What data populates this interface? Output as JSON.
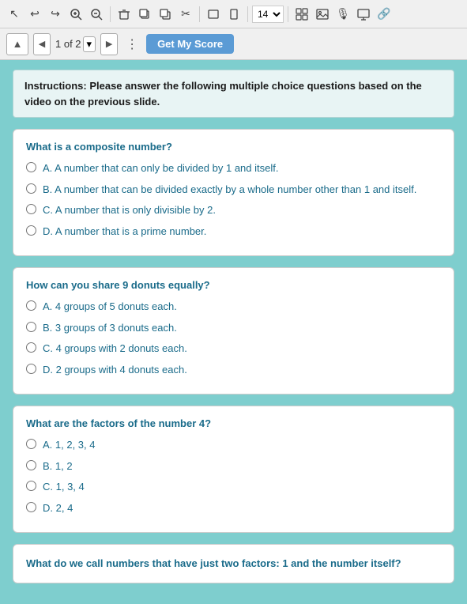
{
  "toolbar": {
    "icons": [
      {
        "name": "cursor",
        "symbol": "↖"
      },
      {
        "name": "undo",
        "symbol": "↩"
      },
      {
        "name": "redo",
        "symbol": "↪"
      },
      {
        "name": "zoom-in",
        "symbol": "🔍+"
      },
      {
        "name": "zoom-out",
        "symbol": "🔍-"
      },
      {
        "name": "delete",
        "symbol": "🗑"
      },
      {
        "name": "copy1",
        "symbol": "⧉"
      },
      {
        "name": "copy2",
        "symbol": "❐"
      },
      {
        "name": "cut",
        "symbol": "✂"
      },
      {
        "name": "frame1",
        "symbol": "▭"
      },
      {
        "name": "frame2",
        "symbol": "▯"
      },
      {
        "name": "zoom-value",
        "symbol": "14"
      },
      {
        "name": "grid",
        "symbol": "⊞"
      },
      {
        "name": "image",
        "symbol": "🖼"
      },
      {
        "name": "mic",
        "symbol": "🎙"
      },
      {
        "name": "screen",
        "symbol": "🖥"
      },
      {
        "name": "link",
        "symbol": "🔗"
      }
    ],
    "zoom_label": "14"
  },
  "nav": {
    "up_icon": "▲",
    "prev_icon": "◀",
    "next_icon": "▶",
    "page_info": "1 of 2",
    "dropdown_arrow": "▾",
    "more_icon": "⋮",
    "get_score_label": "Get My Score"
  },
  "instructions": {
    "text": "Instructions: Please answer the following multiple choice questions based on the video on the previous slide."
  },
  "questions": [
    {
      "id": 1,
      "question": "What is a composite number?",
      "options": [
        {
          "id": "a",
          "label": "A. A number that can only be divided by 1 and itself."
        },
        {
          "id": "b",
          "label": "B. A number that can be divided exactly by a whole number other than 1 and itself."
        },
        {
          "id": "c",
          "label": "C. A number that is only divisible by 2."
        },
        {
          "id": "d",
          "label": "D. A number that is a prime number."
        }
      ]
    },
    {
      "id": 2,
      "question": "How can you share 9 donuts equally?",
      "options": [
        {
          "id": "a",
          "label": "A. 4 groups of 5 donuts each."
        },
        {
          "id": "b",
          "label": "B. 3 groups of 3 donuts each."
        },
        {
          "id": "c",
          "label": "C. 4 groups with 2 donuts each."
        },
        {
          "id": "d",
          "label": "D. 2 groups with 4 donuts each."
        }
      ]
    },
    {
      "id": 3,
      "question": "What are the factors of the number 4?",
      "options": [
        {
          "id": "a",
          "label": "A. 1, 2, 3, 4"
        },
        {
          "id": "b",
          "label": "B. 1, 2"
        },
        {
          "id": "c",
          "label": "C. 1, 3, 4"
        },
        {
          "id": "d",
          "label": "D. 2, 4"
        }
      ]
    }
  ],
  "partial_question": {
    "text": "What do we call numbers that have just two factors: 1 and the number itself?"
  }
}
